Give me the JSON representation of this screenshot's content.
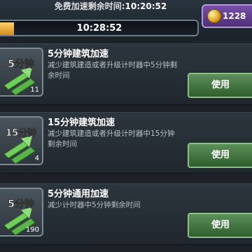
{
  "header": {
    "free_timer_label": "免费加速剩余时间:",
    "free_timer_value": "10:20:52",
    "progress_time": "10:28:52",
    "progress_fraction": 0.07,
    "coins": "1228"
  },
  "items": [
    {
      "icon_text": "5分钟",
      "count": "11",
      "title": "5分钟建筑加速",
      "desc": "减少建筑建造或者升级计时器中5分钟剩余时间",
      "button": "使用"
    },
    {
      "icon_text": "15分钟",
      "count": "4",
      "title": "15分钟建筑加速",
      "desc": "减少建筑建造或者升级计时器中15分钟剩余时间",
      "button": "使用"
    },
    {
      "icon_text": "5分钟",
      "count": "190",
      "title": "5分钟通用加速",
      "desc": "减少计时器中5分钟剩余时间",
      "button": "使用"
    }
  ],
  "colors": {
    "progress_fill": "#e9a22e",
    "button_green": "#3f7a3c",
    "coin_bg": "#6a45a0"
  }
}
